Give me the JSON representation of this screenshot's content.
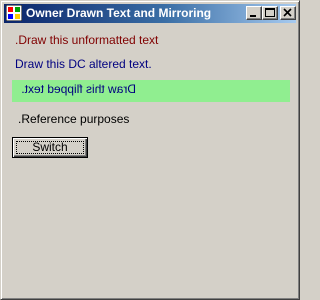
{
  "window": {
    "title": "Owner Drawn Text and Mirroring",
    "app_icon": "windows-app-icon",
    "controls": [
      "minimize-icon",
      "maximize-icon",
      "close-icon"
    ]
  },
  "content": {
    "unformatted_text": ".Draw this unformatted text",
    "dc_altered_text": "Draw this DC altered text.",
    "flipped_text": "Draw this flipped text.",
    "reference_text": ".Reference purposes",
    "switch_button_label": "Switch"
  },
  "colors": {
    "unformatted_text": "#800000",
    "dc_altered_text": "#000080",
    "flipped_band": "#90ee90",
    "title_bar": "#0a246a"
  }
}
